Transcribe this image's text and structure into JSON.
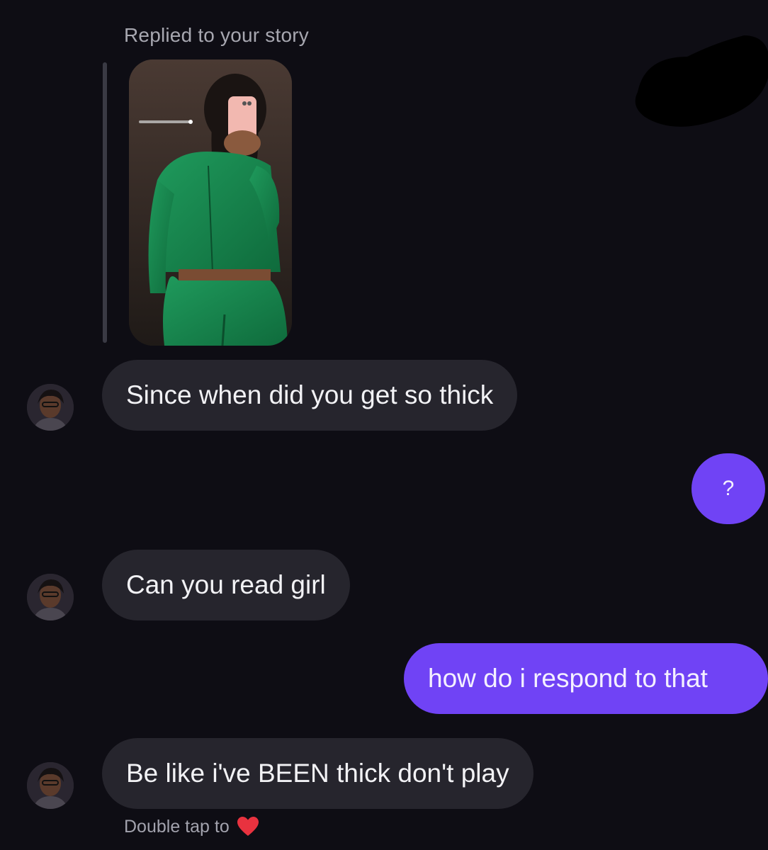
{
  "story_reply": {
    "label": "Replied to your story"
  },
  "messages": [
    {
      "from": "them",
      "text": "Since when did you get so thick"
    },
    {
      "from": "me",
      "text": "?"
    },
    {
      "from": "them",
      "text": "Can you read girl"
    },
    {
      "from": "me",
      "text": "how do i respond to that"
    },
    {
      "from": "them",
      "text": "Be like i've BEEN thick don't play"
    }
  ],
  "footer": {
    "hint": "Double tap to",
    "icon": "heart-icon"
  },
  "colors": {
    "background": "#0e0d14",
    "incoming_bubble": "#26252d",
    "outgoing_bubble": "#7043f5",
    "heart": "#e8323f"
  }
}
